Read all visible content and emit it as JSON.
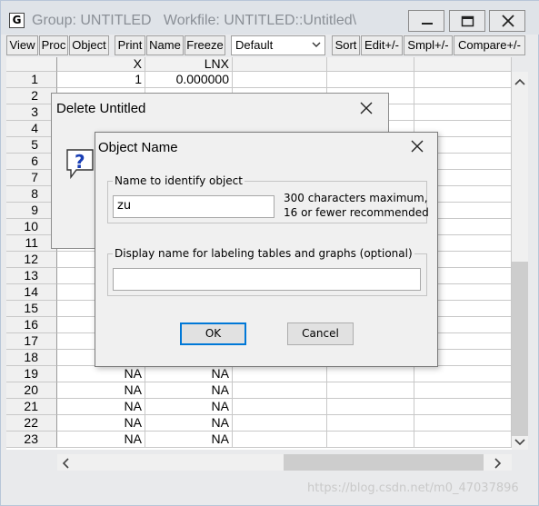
{
  "window": {
    "app_icon_letter": "G",
    "title": "Group: UNTITLED   Workfile: UNTITLED::Untitled\\"
  },
  "toolbar": {
    "buttons": [
      "View",
      "Proc",
      "Object",
      "Print",
      "Name",
      "Freeze",
      "Sort",
      "Edit+/-",
      "Smpl+/-",
      "Compare+/-"
    ],
    "select_value": "Default"
  },
  "grid": {
    "columns": [
      "X",
      "LNX"
    ],
    "rows": [
      {
        "num": "1",
        "x": "1",
        "lnx": "0.000000"
      },
      {
        "num": "2",
        "x": "",
        "lnx": ""
      },
      {
        "num": "3",
        "x": "",
        "lnx": ""
      },
      {
        "num": "4",
        "x": "",
        "lnx": ""
      },
      {
        "num": "5",
        "x": "",
        "lnx": ""
      },
      {
        "num": "6",
        "x": "",
        "lnx": ""
      },
      {
        "num": "7",
        "x": "",
        "lnx": ""
      },
      {
        "num": "8",
        "x": "",
        "lnx": ""
      },
      {
        "num": "9",
        "x": "",
        "lnx": ""
      },
      {
        "num": "10",
        "x": "",
        "lnx": ""
      },
      {
        "num": "11",
        "x": "",
        "lnx": ""
      },
      {
        "num": "12",
        "x": "",
        "lnx": ""
      },
      {
        "num": "13",
        "x": "",
        "lnx": ""
      },
      {
        "num": "14",
        "x": "",
        "lnx": ""
      },
      {
        "num": "15",
        "x": "",
        "lnx": ""
      },
      {
        "num": "16",
        "x": "",
        "lnx": ""
      },
      {
        "num": "17",
        "x": "",
        "lnx": ""
      },
      {
        "num": "18",
        "x": "",
        "lnx": ""
      },
      {
        "num": "19",
        "x": "NA",
        "lnx": "NA"
      },
      {
        "num": "20",
        "x": "NA",
        "lnx": "NA"
      },
      {
        "num": "21",
        "x": "NA",
        "lnx": "NA"
      },
      {
        "num": "22",
        "x": "NA",
        "lnx": "NA"
      },
      {
        "num": "23",
        "x": "NA",
        "lnx": "NA"
      }
    ]
  },
  "delete_dialog": {
    "title": "Delete Untitled"
  },
  "name_dialog": {
    "title": "Object Name",
    "name_group_label": "Name to identify object",
    "name_value": "zu",
    "hint_line1": "300 characters maximum,",
    "hint_line2": "16 or fewer recommended",
    "display_group_label": "Display name for labeling tables and graphs  (optional)",
    "display_value": "",
    "ok_label": "OK",
    "cancel_label": "Cancel"
  },
  "watermark": "https://blog.csdn.net/m0_47037896"
}
